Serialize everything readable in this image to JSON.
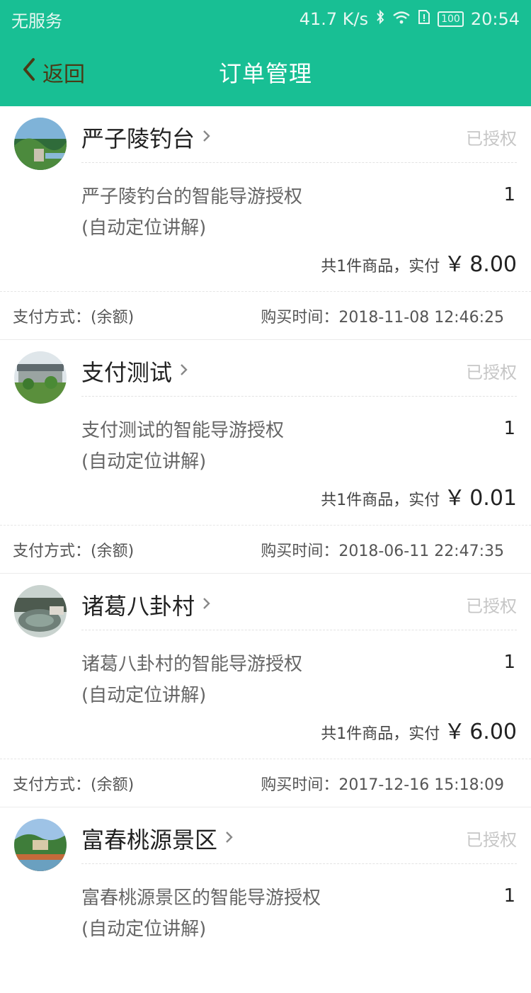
{
  "status_bar": {
    "carrier": "无服务",
    "speed": "41.7 K/s",
    "battery": "100",
    "time": "20:54"
  },
  "nav": {
    "back_label": "返回",
    "title": "订单管理"
  },
  "orders": [
    {
      "name": "严子陵钓台",
      "status": "已授权",
      "item_title": "严子陵钓台的智能导游授权",
      "item_sub": "(自动定位讲解)",
      "qty": "1",
      "total_label": "共1件商品，实付",
      "currency": "￥",
      "amount": "8.00",
      "pay_method": "支付方式：(余额)",
      "purchase_time": "购买时间：2018-11-08 12:46:25"
    },
    {
      "name": "支付测试",
      "status": "已授权",
      "item_title": "支付测试的智能导游授权",
      "item_sub": "(自动定位讲解)",
      "qty": "1",
      "total_label": "共1件商品，实付",
      "currency": "￥",
      "amount": "0.01",
      "pay_method": "支付方式：(余额)",
      "purchase_time": "购买时间：2018-06-11 22:47:35"
    },
    {
      "name": "诸葛八卦村",
      "status": "已授权",
      "item_title": "诸葛八卦村的智能导游授权",
      "item_sub": "(自动定位讲解)",
      "qty": "1",
      "total_label": "共1件商品，实付",
      "currency": "￥",
      "amount": "6.00",
      "pay_method": "支付方式：(余额)",
      "purchase_time": "购买时间：2017-12-16 15:18:09"
    },
    {
      "name": "富春桃源景区",
      "status": "已授权",
      "item_title": "富春桃源景区的智能导游授权",
      "item_sub": "(自动定位讲解)",
      "qty": "1"
    }
  ],
  "colors": {
    "header_bg": "#18bf94",
    "back_arrow": "#4a3a15",
    "status_muted": "#c6c6c6"
  }
}
